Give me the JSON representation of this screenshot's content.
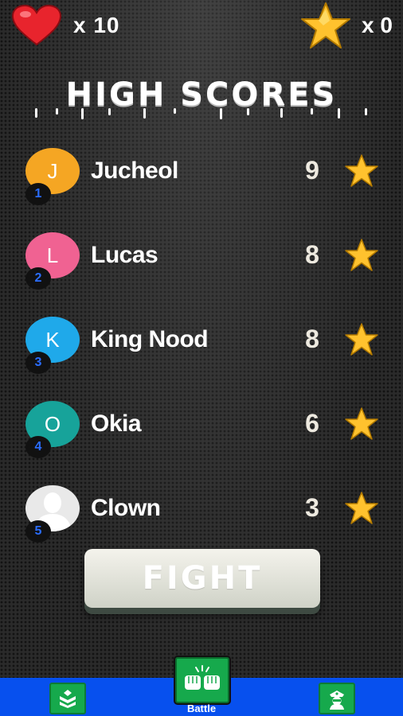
{
  "header": {
    "lives": "x 10",
    "stars": "x 0"
  },
  "title": "HIGH SCORES",
  "leaderboard": [
    {
      "rank": "1",
      "initial": "J",
      "name": "Jucheol",
      "score": "9",
      "avatar_color": "#f5a623"
    },
    {
      "rank": "2",
      "initial": "L",
      "name": "Lucas",
      "score": "8",
      "avatar_color": "#f06292"
    },
    {
      "rank": "3",
      "initial": "K",
      "name": "King Nood",
      "score": "8",
      "avatar_color": "#1fa9ea"
    },
    {
      "rank": "4",
      "initial": "O",
      "name": "Okia",
      "score": "6",
      "avatar_color": "#17a39a"
    },
    {
      "rank": "5",
      "initial": "",
      "name": "Clown",
      "score": "3",
      "avatar_color": "#e9e9e9"
    }
  ],
  "fight_label": "FIGHT",
  "nav": {
    "left_icon": "rank-chevrons-icon",
    "center_icon": "fists-icon",
    "center_label": "Battle",
    "right_icon": "police-icon"
  },
  "colors": {
    "nav_bar": "#0750ee",
    "nav_button": "#16a94c",
    "star": "#ffc22e",
    "heart": "#e8242d",
    "rank_text": "#2a6dff"
  }
}
